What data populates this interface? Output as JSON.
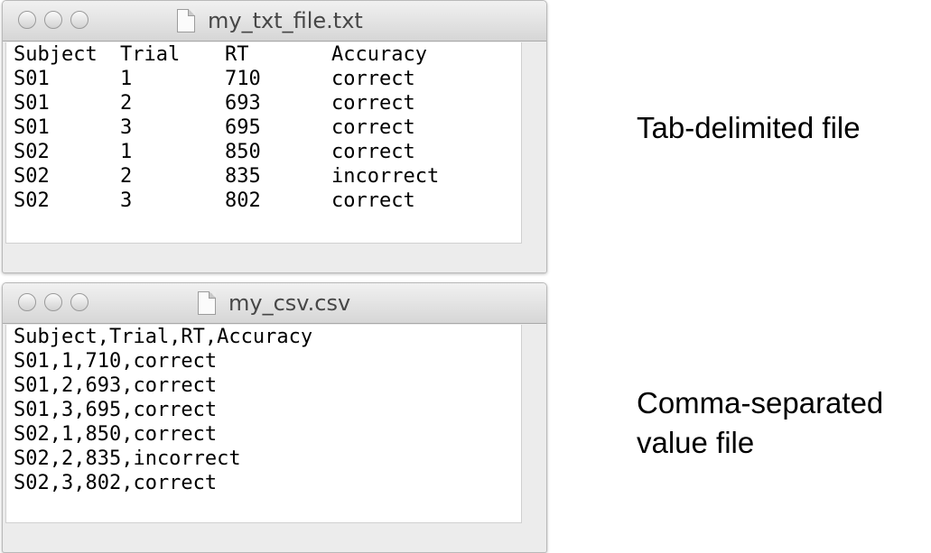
{
  "txt_window": {
    "title": "my_txt_file.txt",
    "header": [
      "Subject",
      "Trial",
      "RT",
      "Accuracy"
    ],
    "rows": [
      [
        "S01",
        "1",
        "710",
        "correct"
      ],
      [
        "S01",
        "2",
        "693",
        "correct"
      ],
      [
        "S01",
        "3",
        "695",
        "correct"
      ],
      [
        "S02",
        "1",
        "850",
        "correct"
      ],
      [
        "S02",
        "2",
        "835",
        "incorrect"
      ],
      [
        "S02",
        "3",
        "802",
        "correct"
      ]
    ]
  },
  "csv_window": {
    "title": "my_csv.csv",
    "lines": [
      "Subject,Trial,RT,Accuracy",
      "S01,1,710,correct",
      "S01,2,693,correct",
      "S01,3,695,correct",
      "S02,1,850,correct",
      "S02,2,835,incorrect",
      "S02,3,802,correct"
    ]
  },
  "captions": {
    "txt": "Tab-delimited file",
    "csv_line1": "Comma-separated",
    "csv_line2": "value file"
  }
}
